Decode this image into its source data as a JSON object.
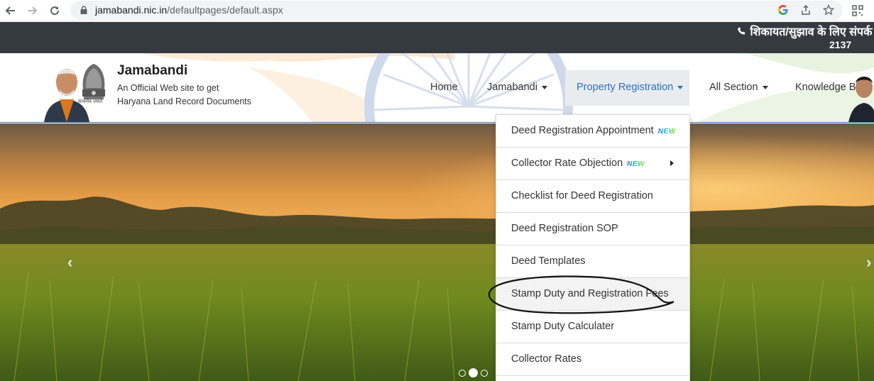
{
  "browser": {
    "url_domain": "jamabandi.nic.in",
    "url_path": "/defaultpages/default.aspx",
    "icons": [
      "back-icon",
      "forward-icon",
      "reload-icon",
      "lock-icon",
      "google-icon",
      "share-icon",
      "star-icon",
      "qr-icon"
    ]
  },
  "ticker": {
    "line1": "शिकायत/सुझाव के लिए संपर्क",
    "line2": "2137"
  },
  "header": {
    "title": "Jamabandi",
    "subtitle_line1": "An Official Web site to get",
    "subtitle_line2": "Haryana Land Record Documents",
    "emblem_motto": "सत्यमेव जयते"
  },
  "nav": {
    "home": "Home",
    "jamabandi": "Jamabandi",
    "property_registration": "Property Registration",
    "all_section": "All Section",
    "knowledge_base": "Knowledge Base"
  },
  "dropdown": {
    "badge": "NEW",
    "items": [
      {
        "label": "Deed Registration Appointment"
      },
      {
        "label": "Collector Rate Objection"
      },
      {
        "label": "Checklist for Deed Registration"
      },
      {
        "label": "Deed Registration SOP"
      },
      {
        "label": "Deed Templates"
      },
      {
        "label": "Stamp Duty and Registration Fees"
      },
      {
        "label": "Stamp Duty Calculater"
      },
      {
        "label": "Collector Rates"
      }
    ]
  },
  "colors": {
    "ticker_bg": "#343a40",
    "nav_active": "#2f6fc0",
    "nav_active_bg": "#e9ecef"
  },
  "carousel": {
    "slide_count": 3,
    "active_slide": 2
  }
}
